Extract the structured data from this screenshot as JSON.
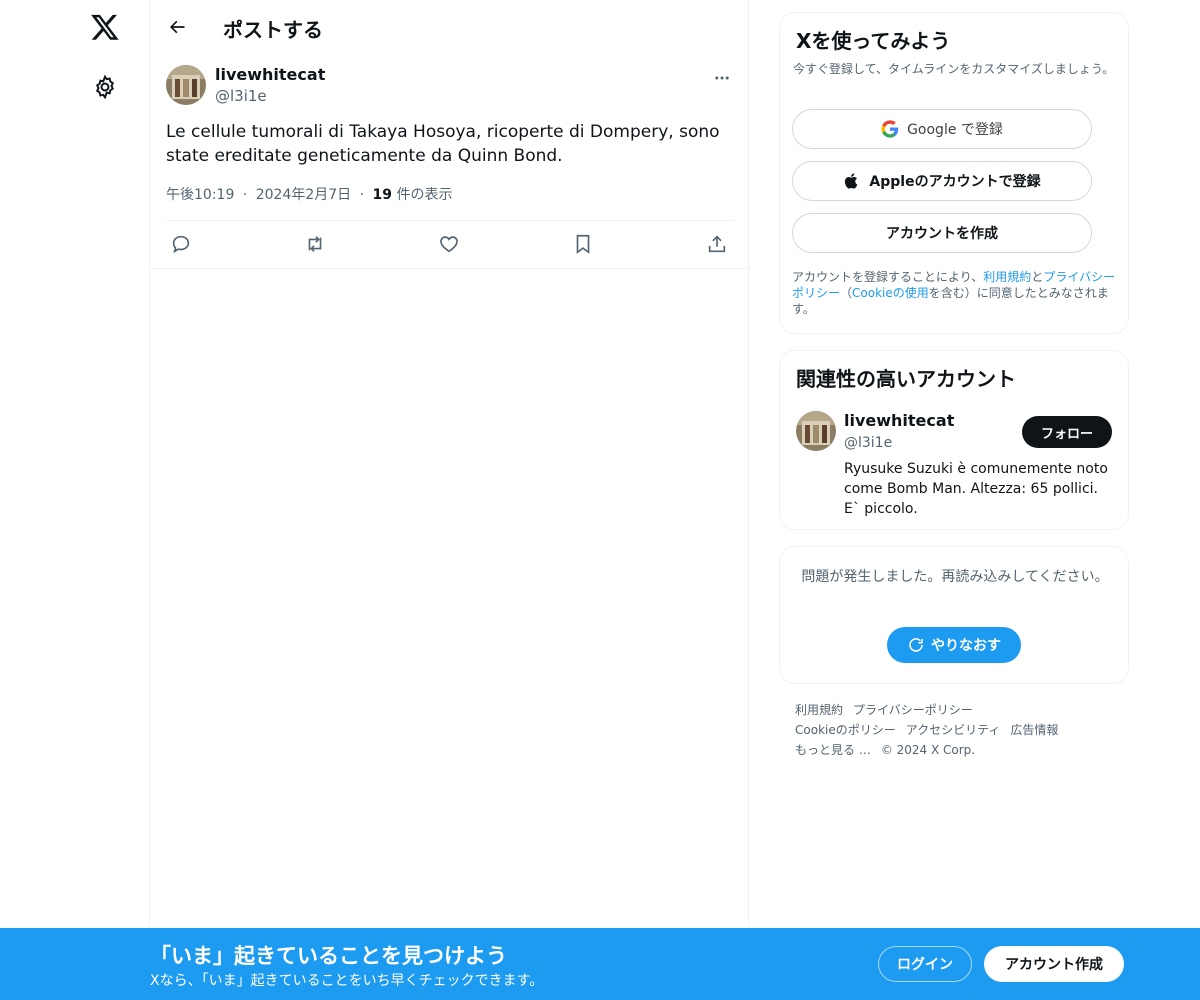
{
  "app": {
    "logo_icon": "x-logo-icon",
    "settings_icon": "gear-icon"
  },
  "header": {
    "back_icon": "arrow-left-icon",
    "title": "ポストする"
  },
  "post": {
    "avatar_icon": "avatar",
    "author_name": "livewhitecat",
    "author_handle": "@l3i1e",
    "more_icon": "more-dots-icon",
    "text": "Le cellule tumorali di Takaya Hosoya, ricoperte di Dompery, sono state ereditate geneticamente da Quinn Bond.",
    "time": "午後10:19",
    "sep1": "·",
    "date": "2024年2月7日",
    "sep2": "·",
    "views_count": "19",
    "views_label": " 件の表示",
    "actions": [
      "reply-icon",
      "repost-icon",
      "like-icon",
      "bookmark-icon",
      "share-icon"
    ]
  },
  "signup_card": {
    "title": "Xを使ってみよう",
    "subtitle": "今すぐ登録して、タイムラインをカスタマイズしましょう。",
    "google_label": "Google で登録",
    "apple_label": "Appleのアカウントで登録",
    "create_label": "アカウントを作成",
    "legal_prefix": "アカウントを登録することにより、",
    "legal_terms": "利用規約",
    "legal_and": "と",
    "legal_privacy": "プライバシーポリシー",
    "legal_paren_open": "（",
    "legal_cookie": "Cookieの使用",
    "legal_suffix": "を含む）に同意したとみなされます。"
  },
  "related_card": {
    "title": "関連性の高いアカウント",
    "name": "livewhitecat",
    "handle": "@l3i1e",
    "follow_label": "フォロー",
    "bio": "Ryusuke Suzuki è comunemente noto come Bomb Man. Altezza: 65 pollici. E` piccolo."
  },
  "error_card": {
    "message": "問題が発生しました。再読み込みしてください。",
    "retry_label": "やりなおす"
  },
  "footer": {
    "links": [
      "利用規約",
      "プライバシーポリシー",
      "Cookieのポリシー",
      "アクセシビリティ",
      "広告情報",
      "もっと見る …",
      "© 2024 X Corp."
    ]
  },
  "banner": {
    "headline": "「いま」起きていることを見つけよう",
    "subline": "Xなら、「いま」起きていることをいち早くチェックできます。",
    "login_label": "ログイン",
    "signup_label": "アカウント作成"
  },
  "colors": {
    "accent": "#1d9bf0",
    "text": "#0f1419",
    "muted": "#536471",
    "border": "#eff3f4"
  }
}
